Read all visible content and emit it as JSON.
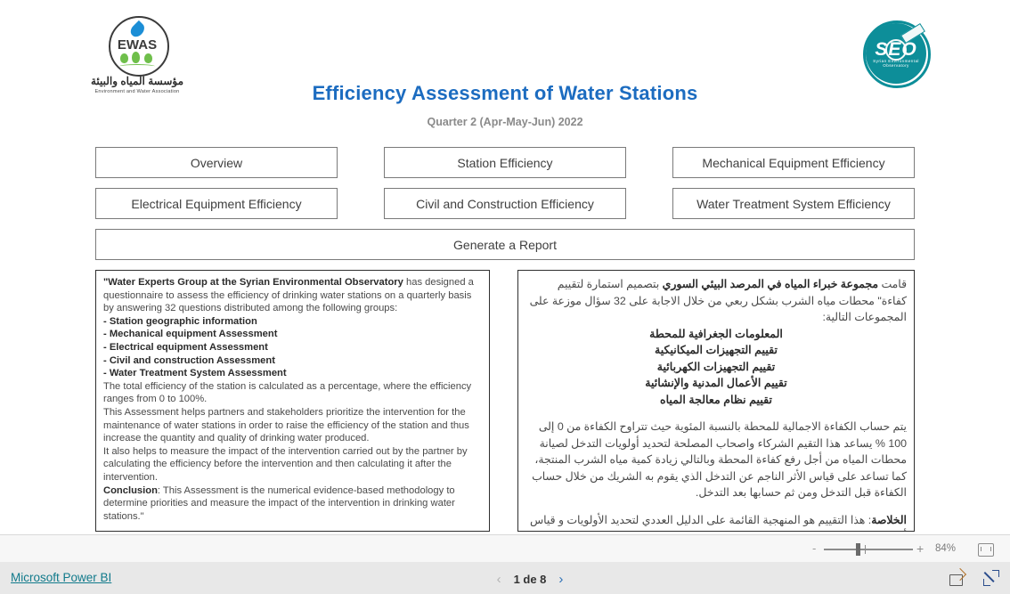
{
  "header": {
    "title": "Efficiency Assessment of Water Stations",
    "subtitle": "Quarter 2 (Apr-May-Jun) 2022",
    "title_color": "#1c6cc0",
    "subtitle_color": "#8a8a8a"
  },
  "logos": {
    "left": {
      "name": "ewas-logo",
      "word": "EWAS",
      "arabic": "مؤسسة المياه والبيئة",
      "english": "Environment and Water Association",
      "drop_color": "#1b8ed6",
      "tree_color": "#6fbf4b"
    },
    "right": {
      "name": "seo-logo",
      "word": "SEO",
      "arc_text": "Syrian Environmental Observatory",
      "color": "#0d8e99"
    }
  },
  "nav": {
    "buttons": [
      {
        "key": "overview",
        "label": "Overview"
      },
      {
        "key": "station",
        "label": "Station Efficiency"
      },
      {
        "key": "mechanical",
        "label": "Mechanical Equipment Efficiency"
      },
      {
        "key": "electrical",
        "label": "Electrical Equipment Efficiency"
      },
      {
        "key": "civil",
        "label": "Civil and Construction Efficiency"
      },
      {
        "key": "water_treatment",
        "label": "Water Treatment System Efficiency"
      }
    ],
    "generate_report": "Generate a Report"
  },
  "panel_en": {
    "p1_bold_open": "\"Water Experts Group at the Syrian Environmental Observatory",
    "p1_rest": " has designed a questionnaire to assess the efficiency of drinking water stations on a quarterly basis by answering 32 questions distributed among the following groups:",
    "groups": [
      "- Station geographic information",
      "- Mechanical equipment Assessment",
      "- Electrical equipment Assessment",
      "- Civil and construction Assessment",
      "- Water Treatment System Assessment"
    ],
    "p2": "The total efficiency of the station is calculated as a percentage, where the efficiency ranges from 0 to 100%.",
    "p3": "This Assessment helps partners and stakeholders prioritize the intervention for the maintenance of water stations in order to raise the efficiency of the station and thus increase the quantity and quality of drinking water produced.",
    "p4": "It also helps to measure the impact of the intervention carried out by the partner by calculating the efficiency before the intervention and then calculating it after the intervention.",
    "conclusion_label": "Conclusion",
    "conclusion_text": ": This Assessment is the numerical evidence-based methodology to determine priorities and measure the impact of the intervention in drinking water stations.\""
  },
  "panel_ar": {
    "p1_pre": "قامت ",
    "p1_bold": "مجموعة خبراء المياه في المرصد البيئي السوري",
    "p1_post": " بتصميم استمارة لتقييم كفاءة\" محطات مياه الشرب بشكل ربعي من خلال الاجابة على 32 سؤال موزعة على المجموعات التالية:",
    "groups": [
      "المعلومات الجغرافية للمحطة",
      "تقييم التجهيزات الميكانيكية",
      "تقييم التجهيزات الكهربائية",
      "تقييم الأعمال المدنية والإنشائية",
      "تقييم نظام معالجة المياه"
    ],
    "p2": "يتم حساب الكفاءة الاجمالية للمحطة بالنسبة المئوية حيث تتراوح الكفاءة من 0 إلى 100 % يساعد هذا التقيم الشركاء واصحاب المصلحة لتحديد أولويات التدخل لصيانة محطات المياه من أجل رفع كفاءة المحطة وبالتالي زيادة كمية مياه الشرب المنتجة، كما تساعد على قياس الأثر الناجم عن التدخل الذي يقوم به الشريك من خلال حساب الكفاءة قبل التدخل ومن ثم حسابها بعد التدخل.",
    "conclusion_label": "الخلاصة",
    "conclusion_text": ": هذا التقييم هو المنهجية القائمة على الدليل العددي لتحديد الأولويات و قياس أثر التدخل في محطات مياه الشرب\""
  },
  "zoom_bar": {
    "minus": "-",
    "plus": "+",
    "level": "84%",
    "fit_icon": "fit-to-page-icon"
  },
  "footer": {
    "brand": "Microsoft Power BI",
    "brand_color": "#117a8b",
    "pager": {
      "prev": "‹",
      "label": "1 de 8",
      "next": "›"
    },
    "share_icon": "share-icon",
    "fullscreen_icon": "fullscreen-icon"
  }
}
